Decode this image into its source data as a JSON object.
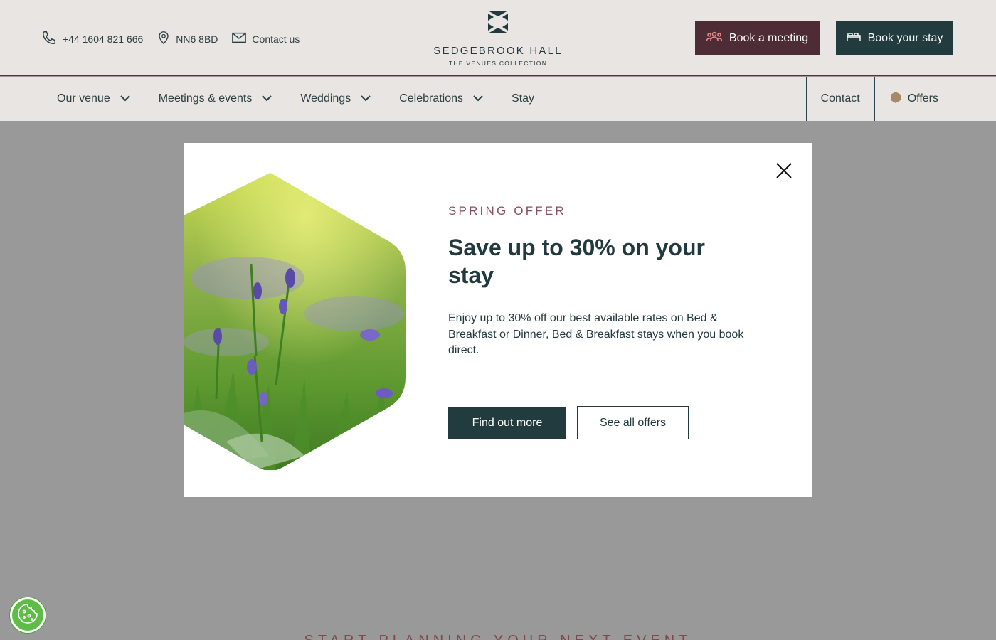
{
  "header": {
    "phone": "+44 1604 821 666",
    "postcode": "NN6 8BD",
    "contact_label": "Contact us",
    "logo_name": "SEDGEBROOK HALL",
    "logo_sub": "THE VENUES COLLECTION",
    "book_meeting_label": "Book a meeting",
    "book_stay_label": "Book your stay"
  },
  "nav": {
    "items": [
      {
        "label": "Our venue"
      },
      {
        "label": "Meetings & events"
      },
      {
        "label": "Weddings"
      },
      {
        "label": "Celebrations"
      },
      {
        "label": "Stay"
      }
    ],
    "contact_label": "Contact",
    "offers_label": "Offers"
  },
  "modal": {
    "eyebrow": "SPRING OFFER",
    "headline": "Save up to 30% on your stay",
    "body": "Enjoy up to 30% off our best available rates on Bed & Breakfast or Dinner, Bed & Breakfast stays when you book direct.",
    "primary_label": "Find out more",
    "secondary_label": "See all offers"
  },
  "background": {
    "strap": "START PLANNING YOUR NEXT EVENT"
  },
  "colors": {
    "brand_dark": "#213b3f",
    "brand_plum": "#4e2c36",
    "accent_rose": "#8a4f5d",
    "header_bg": "#e8e5e2",
    "overlay": "#999999",
    "cookie_green": "#5ebd46"
  },
  "icons": {
    "phone": "phone-icon",
    "location": "map-pin-icon",
    "mail": "envelope-icon",
    "meeting": "people-icon",
    "bed": "bed-icon",
    "chevron": "chevron-down-icon",
    "offers": "hexagon-icon",
    "close": "close-icon",
    "cookie": "cookie-icon"
  }
}
